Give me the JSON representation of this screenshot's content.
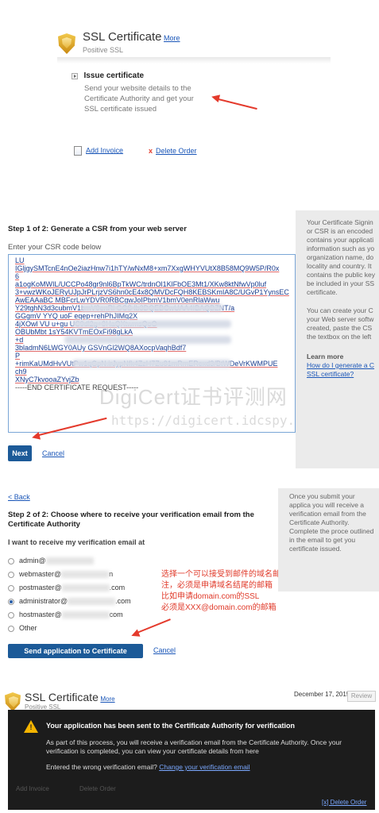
{
  "panel1": {
    "title": "SSL Certificate",
    "more_link": "More",
    "subtitle": "Positive SSL",
    "issue_title": "Issue certificate",
    "issue_desc_1": "Send your website details to the",
    "issue_desc_2": "Certificate Authority and get your",
    "issue_desc_3": "SSL certificate issued",
    "add_invoice": "Add Invoice",
    "delete_order": "Delete Order"
  },
  "panel2": {
    "step_heading": "Step 1 of 2: Generate a CSR from your web server",
    "csr_label": "Enter your CSR code below",
    "csr_lines": [
      "LU",
      "IGljgySMTcnE4nOe2iazHnw7i1hTY/wNxM8+xm7XxgWHYVUtX8B58MQ9W5P/R0x",
      "6",
      "a1ogKoMWIL/UCCPo48gr9nl6BpTkWC/trdnOl1KlFbOE3Mt1/XKw8ktNfwVp0luf",
      "3+vwzWKoJERyUJpJrPLrjzVS6hn0cE4x8QMVDcFQH8KEBSKmIA8C/UGvP1YynsEC",
      "AwEAAaBC                                  MBFcrLwYDVR0RBCgwJoIPbmV1bmV0enRlaWwu",
      "Y29tghN3d3cubmV1bmV0enRl                GCS          lb3DQEBCwUAA4IBAQBZNT/a",
      "GGgmV                                   YYQ        uoF     eqep+rehPhJIMq2X",
      "4jXOwl       VU       u+gu                              UC9dl2g+8HaQXtwmsQoO",
      "OBUbMbt                                                1sY54KVTmEOxFi98gLkA",
      "+d",
      "3bladmN6LWGY0AUy                                 GSVnGl2WQ8AXocpVaqhBdf7",
      "P",
      "+rimKaUMdHvVUtPw1qGpN.irJypNfk4ZzH7Zu81mRmERexd3/BtWDeVrKWMPUE",
      "ch9",
      "XNyC7kvooaZYvjZb",
      "-----END CERTIFICATE REQUEST-----"
    ],
    "side_text_1": "Your Certificate Signin or CSR is an encoded contains your applicati information such as yo organization name, do locality and country. It contains the public key be included in your SS certificate.",
    "side_text_2": "You can create your C your Web server softw created, paste the CS the textbox on the left",
    "learn_more": "Learn more",
    "learn_link": "How do I generate a C SSL certificate?",
    "next_button": "Next",
    "cancel_link": "Cancel",
    "watermark_1": "DigiCert证书评测网",
    "watermark_2": "https://digicert.idcspy.com/"
  },
  "panel3": {
    "back_link": "< Back",
    "step_heading_1": "Step 2 of 2: Choose where to receive your verification email from the",
    "step_heading_2": "Certificate Authority",
    "question": "I want to receive my verification email at",
    "options": [
      {
        "prefix": "admin@",
        "suffix": "",
        "selected": false
      },
      {
        "prefix": "webmaster@",
        "suffix": "n",
        "selected": false
      },
      {
        "prefix": "postmaster@",
        "suffix": ".com",
        "selected": false
      },
      {
        "prefix": "administrator@",
        "suffix": ".com",
        "selected": true
      },
      {
        "prefix": "hostmaster@",
        "suffix": "com",
        "selected": false
      },
      {
        "prefix": "Other",
        "suffix": "",
        "selected": false
      }
    ],
    "note_1": "选择一个可以接受到邮件的域名邮箱",
    "note_2": "注，必须是申请域名结尾的邮箱",
    "note_3": "比如申请domain.com的SSL",
    "note_4": "必须是XXX@domain.com的邮箱",
    "send_button": "Send application to Certificate Authority",
    "cancel_link": "Cancel",
    "side_text": "Once you submit your applica you will receive a verification email from the Certificate Authority. Complete the proce outlined in the email to get you certificate issued."
  },
  "panel4": {
    "title": "SSL Certificate",
    "more_link": "More",
    "subtitle": "Positive SSL",
    "date": "December 17, 2015",
    "review_button": "Review",
    "alert_title": "Your application has been sent to the Certificate Authority for verification",
    "alert_body_1": "As part of this process, you will receive a verification email from the Certificate Authority. Once your",
    "alert_body_2": "verification is completed, you can view your certificate details from here",
    "wrong_email_text": "Entered the wrong verification email?",
    "change_email_link": "Change your verification email",
    "ghost_add_invoice": "Add Invoice",
    "ghost_delete_order": "Delete Order",
    "close_link": "[x] Delete Order"
  },
  "colors": {
    "link_blue": "#1a56b8",
    "button_blue": "#1c5a98",
    "annotation_red": "#e43a2c",
    "side_panel_gray": "#ebebeb",
    "overlay_dark": "#1c1c1c",
    "warning_yellow": "#f4b400"
  }
}
